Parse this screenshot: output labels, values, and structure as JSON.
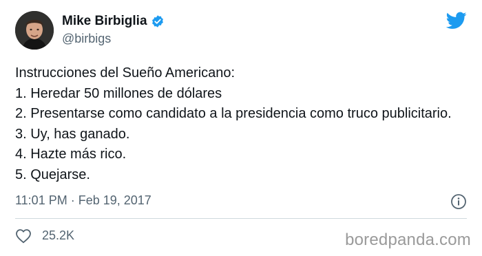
{
  "user": {
    "name": "Mike Birbiglia",
    "handle": "@birbigs"
  },
  "tweet": {
    "lines": [
      "Instrucciones del Sueño Americano:",
      "1. Heredar 50 millones de dólares",
      "2. Presentarse como candidato a la presidencia como truco publicitario.",
      "3. Uy, has ganado.",
      "4. Hazte más rico.",
      "5. Quejarse."
    ],
    "timestamp": "11:01 PM · Feb 19, 2017",
    "likes": "25.2K"
  },
  "icons": {
    "verified": "verified-badge-icon",
    "logo": "twitter-bird-icon",
    "info": "info-icon",
    "like": "heart-icon"
  },
  "colors": {
    "twitter_blue": "#1d9bf0",
    "secondary_text": "#536471",
    "primary_text": "#0f1419"
  },
  "watermark": "boredpanda.com"
}
